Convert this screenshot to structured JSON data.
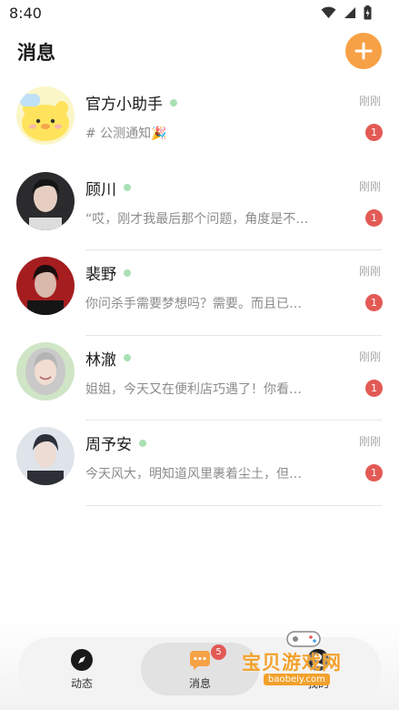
{
  "status_bar": {
    "time": "8:40"
  },
  "header": {
    "title": "消息"
  },
  "chats": [
    {
      "name": "官方小助手",
      "time": "刚刚",
      "preview": "# 公测通知🎉",
      "unread": "1"
    },
    {
      "name": "顾川",
      "time": "刚刚",
      "preview": "“哎，刚才我最后那个问题，角度是不…",
      "unread": "1"
    },
    {
      "name": "裴野",
      "time": "刚刚",
      "preview": "你问杀手需要梦想吗？需要。而且已…",
      "unread": "1"
    },
    {
      "name": "林澈",
      "time": "刚刚",
      "preview": "姐姐，今天又在便利店巧遇了！你看…",
      "unread": "1"
    },
    {
      "name": "周予安",
      "time": "刚刚",
      "preview": "今天风大，明知道风里裹着尘土，但…",
      "unread": "1"
    }
  ],
  "tab_bar": {
    "tabs": [
      {
        "label": "动态",
        "icon": "compass-icon"
      },
      {
        "label": "消息",
        "icon": "chat-bubble-icon",
        "badge": "5"
      },
      {
        "label": "我的",
        "icon": "profile-icon"
      }
    ]
  },
  "watermark": {
    "text": "宝贝游戏网",
    "url": "baobeiy.com"
  },
  "colors": {
    "accent": "#f7a146",
    "badge": "#e35a55",
    "online": "#a9e0b4"
  }
}
